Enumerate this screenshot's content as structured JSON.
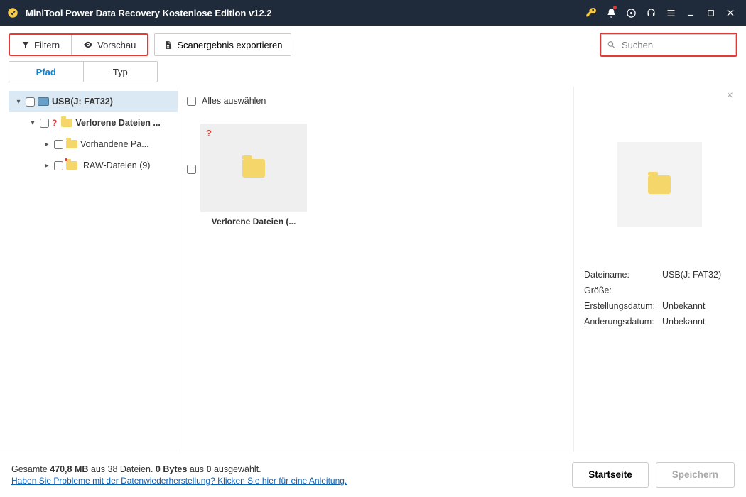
{
  "title": "MiniTool Power Data Recovery Kostenlose Edition v12.2",
  "toolbar": {
    "filter": "Filtern",
    "preview": "Vorschau",
    "export": "Scanergebnis exportieren"
  },
  "search": {
    "placeholder": "Suchen"
  },
  "tabs": {
    "path": "Pfad",
    "type": "Typ"
  },
  "tree": {
    "root": "USB(J: FAT32)",
    "lost": "Verlorene Dateien ...",
    "existing": "Vorhandene Pa...",
    "raw": "RAW-Dateien (9)"
  },
  "center": {
    "select_all": "Alles auswählen",
    "item1": "Verlorene Dateien (..."
  },
  "detail": {
    "filename_k": "Dateiname:",
    "filename_v": "USB(J: FAT32)",
    "size_k": "Größe:",
    "size_v": "",
    "created_k": "Erstellungsdatum:",
    "created_v": "Unbekannt",
    "modified_k": "Änderungsdatum:",
    "modified_v": "Unbekannt"
  },
  "footer": {
    "total_prefix": "Gesamte ",
    "total_size": "470,8 MB",
    "total_mid": " aus ",
    "total_files": "38",
    "total_suffix": " Dateien.  ",
    "sel_bytes": "0 Bytes",
    "sel_mid": " aus ",
    "sel_count": "0",
    "sel_suffix": " ausgewählt.",
    "help_link": "Haben Sie Probleme mit der Datenwiederherstellung? Klicken Sie hier für eine Anleitung.",
    "home": "Startseite",
    "save": "Speichern"
  }
}
